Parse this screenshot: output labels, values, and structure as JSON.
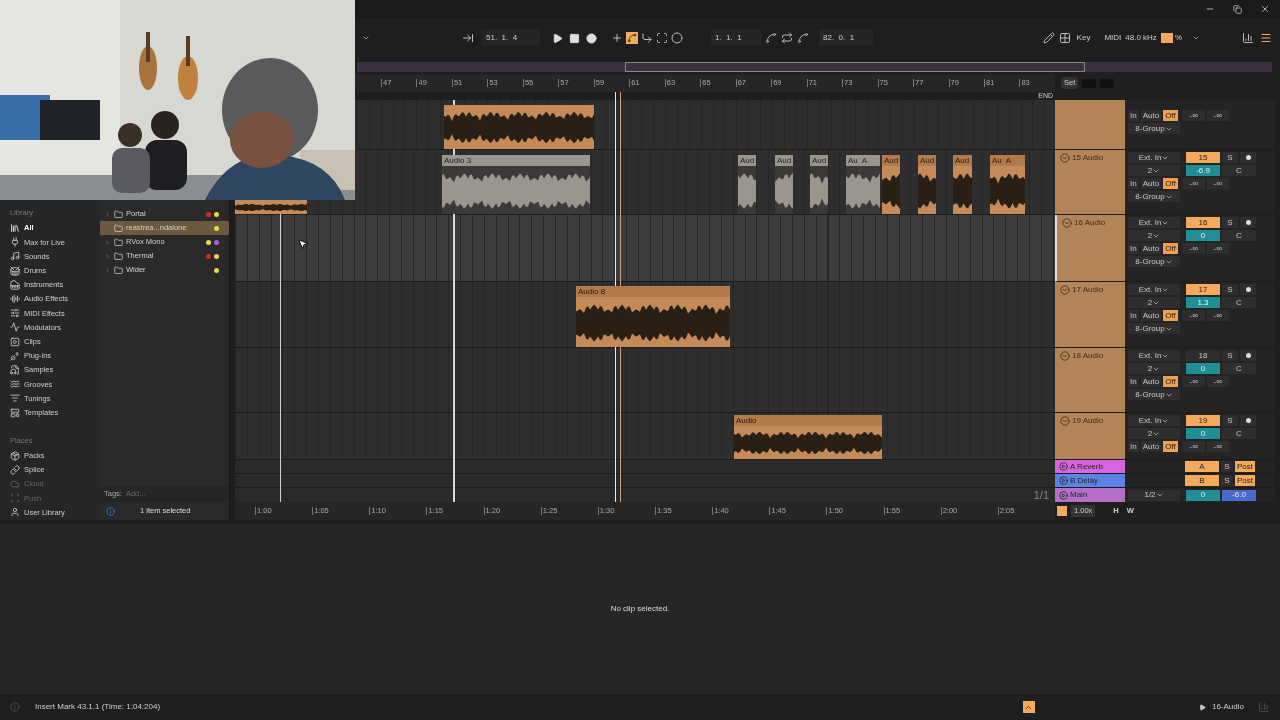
{
  "transport": {
    "position": "51.  1.  4",
    "loop_start": "1.  1.  1",
    "loop_length": "82.  0.  1",
    "draw_mode_on": true,
    "key_label": "Key",
    "midi_label": "MIDI",
    "sample_rate": "48.0 kHz",
    "cpu_label": "%"
  },
  "browser": {
    "library_heading": "Library",
    "library": [
      {
        "label": "All",
        "selected": true
      },
      {
        "label": "Max for Live",
        "selected": false
      },
      {
        "label": "Sounds",
        "selected": false
      },
      {
        "label": "Drums",
        "selected": false
      },
      {
        "label": "Instruments",
        "selected": false
      },
      {
        "label": "Audio Effects",
        "selected": false
      },
      {
        "label": "MIDI Effects",
        "selected": false
      },
      {
        "label": "Modulators",
        "selected": false
      },
      {
        "label": "Clips",
        "selected": false
      },
      {
        "label": "Plug-ins",
        "selected": false
      },
      {
        "label": "Samples",
        "selected": false
      },
      {
        "label": "Grooves",
        "selected": false
      },
      {
        "label": "Tunings",
        "selected": false
      },
      {
        "label": "Templates",
        "selected": false
      }
    ],
    "places_heading": "Places",
    "places": [
      {
        "label": "Packs",
        "disabled": false
      },
      {
        "label": "Splice",
        "disabled": false
      },
      {
        "label": "Cloud",
        "disabled": true
      },
      {
        "label": "Push",
        "disabled": true
      },
      {
        "label": "User Library",
        "disabled": false
      }
    ],
    "items": [
      {
        "label": "Portal",
        "selected": false,
        "expandable": true,
        "tags": [
          {
            "color": "#d42a2a"
          },
          {
            "color": "#e8d84a"
          }
        ]
      },
      {
        "label": "reastrea...ndalone",
        "selected": true,
        "expandable": false,
        "tags": [
          {
            "color": "#e8d84a"
          }
        ]
      },
      {
        "label": "RVox Mono",
        "selected": false,
        "expandable": true,
        "tags": [
          {
            "color": "#e8d84a"
          },
          {
            "color": "#a65ee0"
          }
        ]
      },
      {
        "label": "Thermal",
        "selected": false,
        "expandable": true,
        "tags": [
          {
            "color": "#d42a2a"
          },
          {
            "color": "#e8d84a"
          }
        ]
      },
      {
        "label": "Wider",
        "selected": false,
        "expandable": true,
        "tags": [
          {
            "color": "#e8d84a"
          }
        ]
      }
    ],
    "tags_label": "Tags:",
    "tags_placeholder": "Add...",
    "selection_status": "1 item selected"
  },
  "arrangement": {
    "bars": [
      "47",
      "49",
      "51",
      "53",
      "55",
      "57",
      "59",
      "61",
      "63",
      "65",
      "67",
      "69",
      "71",
      "73",
      "75",
      "77",
      "79",
      "81",
      "83"
    ],
    "set_button": "Set",
    "end_label": "END",
    "page": "1/1",
    "zoom": "1.00x",
    "h_button": "H",
    "w_button": "W",
    "times": [
      "1:00",
      "1:05",
      "1:10",
      "1:15",
      "1:20",
      "1:25",
      "1:30",
      "1:35",
      "1:40",
      "1:45",
      "1:50",
      "1:55",
      "2:00",
      "2:05"
    ]
  },
  "partial_track": {
    "monitor": [
      {
        "label": "In",
        "selected": false
      },
      {
        "label": "Auto",
        "selected": false
      },
      {
        "label": "Off",
        "selected": true
      }
    ],
    "sends": [
      "-∞",
      "-∞"
    ],
    "output": "8-Group",
    "clips": [
      {
        "active": true
      }
    ]
  },
  "tracks": [
    {
      "name": "15 Audio",
      "input": "Ext. In",
      "channel": "2",
      "number": "15",
      "number_active": true,
      "solo": "S",
      "volume": "-6.9",
      "pan": "C",
      "monitor": [
        {
          "label": "In",
          "selected": false
        },
        {
          "label": "Auto",
          "selected": false
        },
        {
          "label": "Off",
          "selected": true
        }
      ],
      "sends": [
        "-∞",
        "-∞"
      ],
      "output": "8-Group",
      "selected": false,
      "clips": [
        {
          "active": true
        },
        {
          "title": "Audio 3",
          "active": false
        },
        {
          "title": "Aud",
          "active": false
        },
        {
          "title": "Aud",
          "active": false
        },
        {
          "title": "Aud",
          "active": false
        },
        {
          "title": "Au  A",
          "active": false
        },
        {
          "title": "Aud",
          "active": true
        },
        {
          "title": "Aud",
          "active": true
        },
        {
          "title": "Aud",
          "active": true
        },
        {
          "title": "Au  A",
          "active": true
        }
      ]
    },
    {
      "name": "16 Audio",
      "input": "Ext. In",
      "channel": "2",
      "number": "16",
      "number_active": true,
      "solo": "S",
      "volume": "0",
      "pan": "C",
      "monitor": [
        {
          "label": "In",
          "selected": false
        },
        {
          "label": "Auto",
          "selected": false
        },
        {
          "label": "Off",
          "selected": true
        }
      ],
      "sends": [
        "-∞",
        "-∞"
      ],
      "output": "8-Group",
      "selected": true
    },
    {
      "name": "17 Audio",
      "input": "Ext. In",
      "channel": "2",
      "number": "17",
      "number_active": true,
      "solo": "S",
      "volume": "1.3",
      "pan": "C",
      "monitor": [
        {
          "label": "In",
          "selected": false
        },
        {
          "label": "Auto",
          "selected": false
        },
        {
          "label": "Off",
          "selected": true
        }
      ],
      "sends": [
        "-∞",
        "-∞"
      ],
      "output": "8-Group",
      "selected": false,
      "clips": [
        {
          "title": "Audio 8",
          "active": true
        }
      ]
    },
    {
      "name": "18 Audio",
      "input": "Ext. In",
      "channel": "2",
      "number": "18",
      "number_active": false,
      "solo": "S",
      "volume": "0",
      "pan": "C",
      "monitor": [
        {
          "label": "In",
          "selected": false
        },
        {
          "label": "Auto",
          "selected": false
        },
        {
          "label": "Off",
          "selected": true
        }
      ],
      "sends": [
        "-∞",
        "-∞"
      ],
      "output": "8-Group",
      "selected": false
    },
    {
      "name": "19 Audio",
      "input": "Ext. In",
      "channel": "2",
      "number": "19",
      "number_active": true,
      "solo": "S",
      "volume": "0",
      "pan": "C",
      "monitor": [
        {
          "label": "In",
          "selected": false
        },
        {
          "label": "Auto",
          "selected": false
        },
        {
          "label": "Off",
          "selected": true
        }
      ],
      "sends": [
        "-∞",
        "-∞"
      ],
      "selected": false,
      "clips": [
        {
          "title": "Audio",
          "active": true
        }
      ]
    }
  ],
  "returns": [
    {
      "name": "A Reverb",
      "color": "#d865e0",
      "send": "A",
      "solo": "S",
      "post": "Post"
    },
    {
      "name": "B Delay",
      "color": "#5d82e6",
      "send": "B",
      "solo": "S",
      "post": "Post"
    }
  ],
  "main": {
    "name": "Main",
    "color": "#b46fc6",
    "routing": "1/2",
    "volume": "0",
    "pan": "-6.0"
  },
  "detail": {
    "message": "No clip selected."
  },
  "status": {
    "message": "Insert Mark 43.1.1 (Time: 1:04:204)",
    "track": "16-Audio"
  }
}
